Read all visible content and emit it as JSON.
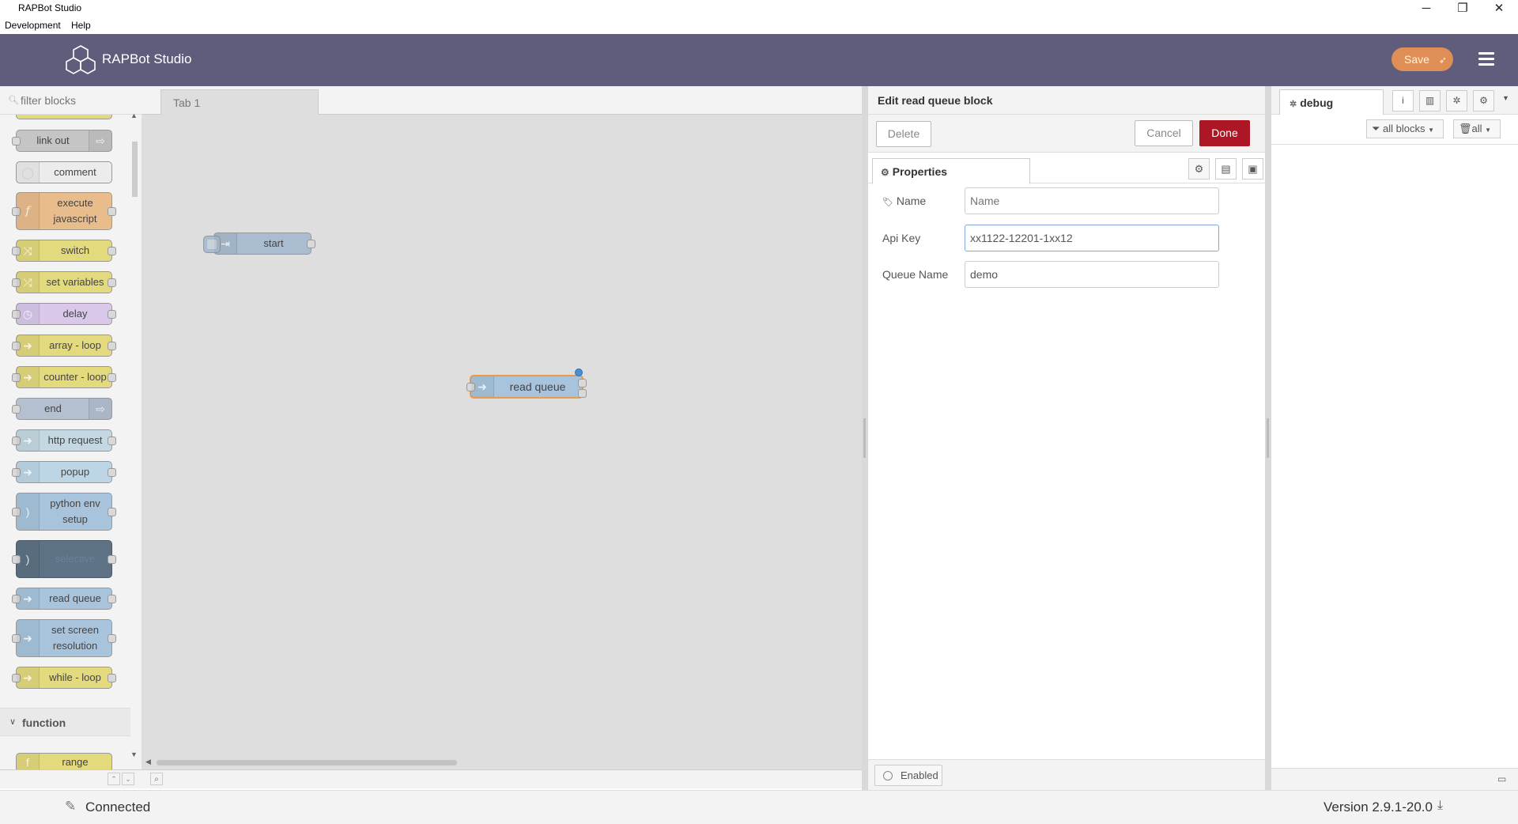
{
  "window": {
    "title": "RAPBot Studio",
    "minimize": "─",
    "maximize": "❐",
    "close": "✕"
  },
  "menu": {
    "development": "Development",
    "help": "Help"
  },
  "header": {
    "app_title": "RAPBot Studio",
    "save_label": "Save",
    "save_icon": "rocket-icon"
  },
  "palette": {
    "filter_placeholder": "filter blocks",
    "nodes": [
      {
        "label": "link out",
        "color": "#c5c5c5"
      },
      {
        "label": "comment",
        "color": "#ececec"
      },
      {
        "label": "execute javascript",
        "color": "#e9bc8c"
      },
      {
        "label": "switch",
        "color": "#e3d97d"
      },
      {
        "label": "set variables",
        "color": "#e3d97d"
      },
      {
        "label": "delay",
        "color": "#d9c8ea"
      },
      {
        "label": "array - loop",
        "color": "#e3d97d"
      },
      {
        "label": "counter - loop",
        "color": "#e3d97d"
      },
      {
        "label": "end",
        "color": "#b4bfd0"
      },
      {
        "label": "http request",
        "color": "#c3d8e3"
      },
      {
        "label": "popup",
        "color": "#bdd6e6"
      },
      {
        "label": "python env setup",
        "color": "#a7c4dc"
      },
      {
        "label": "selective",
        "color": "#5d7285"
      },
      {
        "label": "read queue",
        "color": "#a7c4dc"
      },
      {
        "label": "set screen resolution",
        "color": "#a7c4dc"
      },
      {
        "label": "while - loop",
        "color": "#e3d97d"
      }
    ],
    "category": "function",
    "category_first_node": "range"
  },
  "workspace": {
    "tab": "Tab 1",
    "nodes": [
      {
        "label": "start",
        "color": "#a9bcd0"
      },
      {
        "label": "read queue",
        "color": "#a7c4dc"
      }
    ]
  },
  "editor": {
    "title": "Edit read queue block",
    "delete": "Delete",
    "cancel": "Cancel",
    "done": "Done",
    "tab": "Properties",
    "fields": {
      "name_label": "Name",
      "name_placeholder": "Name",
      "name_value": "",
      "apikey_label": "Api Key",
      "apikey_value": "xx1122-12201-1xx12",
      "queue_label": "Queue Name",
      "queue_value": "demo"
    },
    "enabled": "Enabled"
  },
  "sidebar": {
    "tab": "debug",
    "filter_blocks": "all blocks",
    "filter_clear": "all"
  },
  "status": {
    "connected": "Connected",
    "version": "Version 2.9.1-20.0"
  }
}
